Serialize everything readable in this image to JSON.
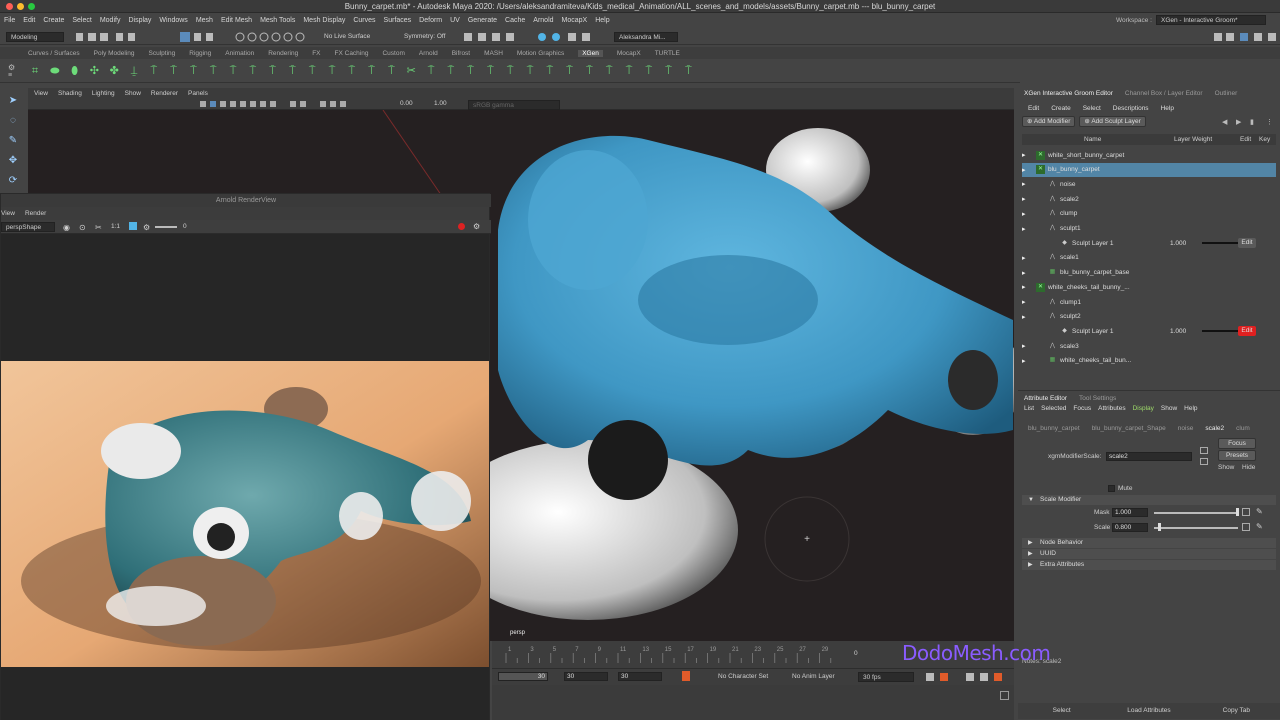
{
  "window": {
    "title": "Bunny_carpet.mb* - Autodesk Maya 2020: /Users/aleksandramiteva/Kids_medical_Animation/ALL_scenes_and_models/assets/Bunny_carpet.mb  ---  blu_bunny_carpet"
  },
  "menubar": [
    "File",
    "Edit",
    "Create",
    "Select",
    "Modify",
    "Display",
    "Windows",
    "Mesh",
    "Edit Mesh",
    "Mesh Tools",
    "Mesh Display",
    "Curves",
    "Surfaces",
    "Deform",
    "UV",
    "Generate",
    "Cache",
    "Arnold",
    "MocapX",
    "Help"
  ],
  "workspace": {
    "label": "Workspace :",
    "value": "XGen - Interactive Groom*"
  },
  "statusline": {
    "mode": "Modeling",
    "live_surface": "No Live Surface",
    "symmetry": "Symmetry: Off",
    "user": "Aleksandra Mi..."
  },
  "shelf_tabs": [
    "Curves / Surfaces",
    "Poly Modeling",
    "Sculpting",
    "Rigging",
    "Animation",
    "Rendering",
    "FX",
    "FX Caching",
    "Custom",
    "Arnold",
    "Bifrost",
    "MASH",
    "Motion Graphics",
    "XGen",
    "MocapX",
    "TURTLE"
  ],
  "shelf_active": "XGen",
  "viewport": {
    "menu": [
      "View",
      "Shading",
      "Lighting",
      "Show",
      "Renderer",
      "Panels"
    ],
    "value_a": "0.00",
    "value_b": "1.00",
    "colorspace": "sRGB gamma",
    "camera_label": "persp"
  },
  "arnold_renderview": {
    "title": "Arnold RenderView",
    "menu": [
      "View",
      "Render"
    ],
    "camera": "perspShape",
    "ratio": "1:1",
    "exposure": "0"
  },
  "timeline": {
    "ticks": [
      "1",
      "3",
      "5",
      "7",
      "9",
      "11",
      "13",
      "15",
      "17",
      "19",
      "21",
      "23",
      "25",
      "27",
      "29"
    ],
    "current": "0",
    "range_start": "30",
    "range_a": "30",
    "range_b": "30",
    "character_set": "No Character Set",
    "anim_layer": "No Anim Layer",
    "fps": "30 fps"
  },
  "xgen_editor": {
    "tabs": [
      "XGen Interactive Groom Editor",
      "Channel Box / Layer Editor",
      "Outliner"
    ],
    "menu": [
      "Edit",
      "Create",
      "Select",
      "Descriptions",
      "Help"
    ],
    "add_modifier": "Add Modifier",
    "add_sculpt_layer": "Add Sculpt Layer",
    "columns": {
      "name": "Name",
      "layer_weight": "Layer Weight",
      "edit": "Edit",
      "key": "Key"
    },
    "tree": [
      {
        "label": "white_short_bunny_carpet",
        "indent": 0,
        "icon": "description",
        "selected": false
      },
      {
        "label": "blu_bunny_carpet",
        "indent": 0,
        "icon": "description",
        "selected": true
      },
      {
        "label": "noise",
        "indent": 1,
        "icon": "modifier",
        "selected": false
      },
      {
        "label": "scale2",
        "indent": 1,
        "icon": "modifier",
        "selected": false
      },
      {
        "label": "clump",
        "indent": 1,
        "icon": "modifier",
        "selected": false
      },
      {
        "label": "sculpt1",
        "indent": 1,
        "icon": "modifier",
        "selected": false
      },
      {
        "label": "Sculpt Layer 1",
        "indent": 2,
        "icon": "layer",
        "weight": "1.000",
        "edit": "Edit",
        "edit_active": false
      },
      {
        "label": "scale1",
        "indent": 1,
        "icon": "modifier",
        "selected": false
      },
      {
        "label": "blu_bunny_carpet_base",
        "indent": 1,
        "icon": "base",
        "selected": false
      },
      {
        "label": "white_cheeks_tail_bunny_...",
        "indent": 0,
        "icon": "description",
        "selected": false
      },
      {
        "label": "clump1",
        "indent": 1,
        "icon": "modifier",
        "selected": false
      },
      {
        "label": "sculpt2",
        "indent": 1,
        "icon": "modifier",
        "selected": false
      },
      {
        "label": "Sculpt Layer 1",
        "indent": 2,
        "icon": "layer",
        "weight": "1.000",
        "edit": "Edit",
        "edit_active": true
      },
      {
        "label": "scale3",
        "indent": 1,
        "icon": "modifier",
        "selected": false
      },
      {
        "label": "white_cheeks_tail_bun...",
        "indent": 1,
        "icon": "base",
        "selected": false
      }
    ]
  },
  "attribute_editor": {
    "tabs": [
      "Attribute Editor",
      "Tool Settings"
    ],
    "menu": [
      "List",
      "Selected",
      "Focus",
      "Attributes",
      "Display",
      "Show",
      "Help"
    ],
    "node_tabs": [
      "blu_bunny_carpet",
      "blu_bunny_carpet_Shape",
      "noise",
      "scale2",
      "clum"
    ],
    "active_node_tab": "scale2",
    "field_label": "xgmModifierScale:",
    "field_value": "scale2",
    "focus_btn": "Focus",
    "presets_btn": "Presets",
    "show_btn": "Show",
    "hide_btn": "Hide",
    "mute_label": "Mute",
    "sections": [
      "Scale Modifier",
      "Node Behavior",
      "UUID",
      "Extra Attributes"
    ],
    "mask_label": "Mask",
    "mask_value": "1.000",
    "scale_label": "Scale",
    "scale_value": "0.800",
    "notes": "Notes:  scale2",
    "bottom_buttons": [
      "Select",
      "Load Attributes",
      "Copy Tab"
    ]
  },
  "watermark": "DodoMesh.com",
  "colors": {
    "selection": "#5285a6",
    "edit_active": "#e02020",
    "fur": "#3f97c4",
    "watermark": "#8a5cff"
  }
}
